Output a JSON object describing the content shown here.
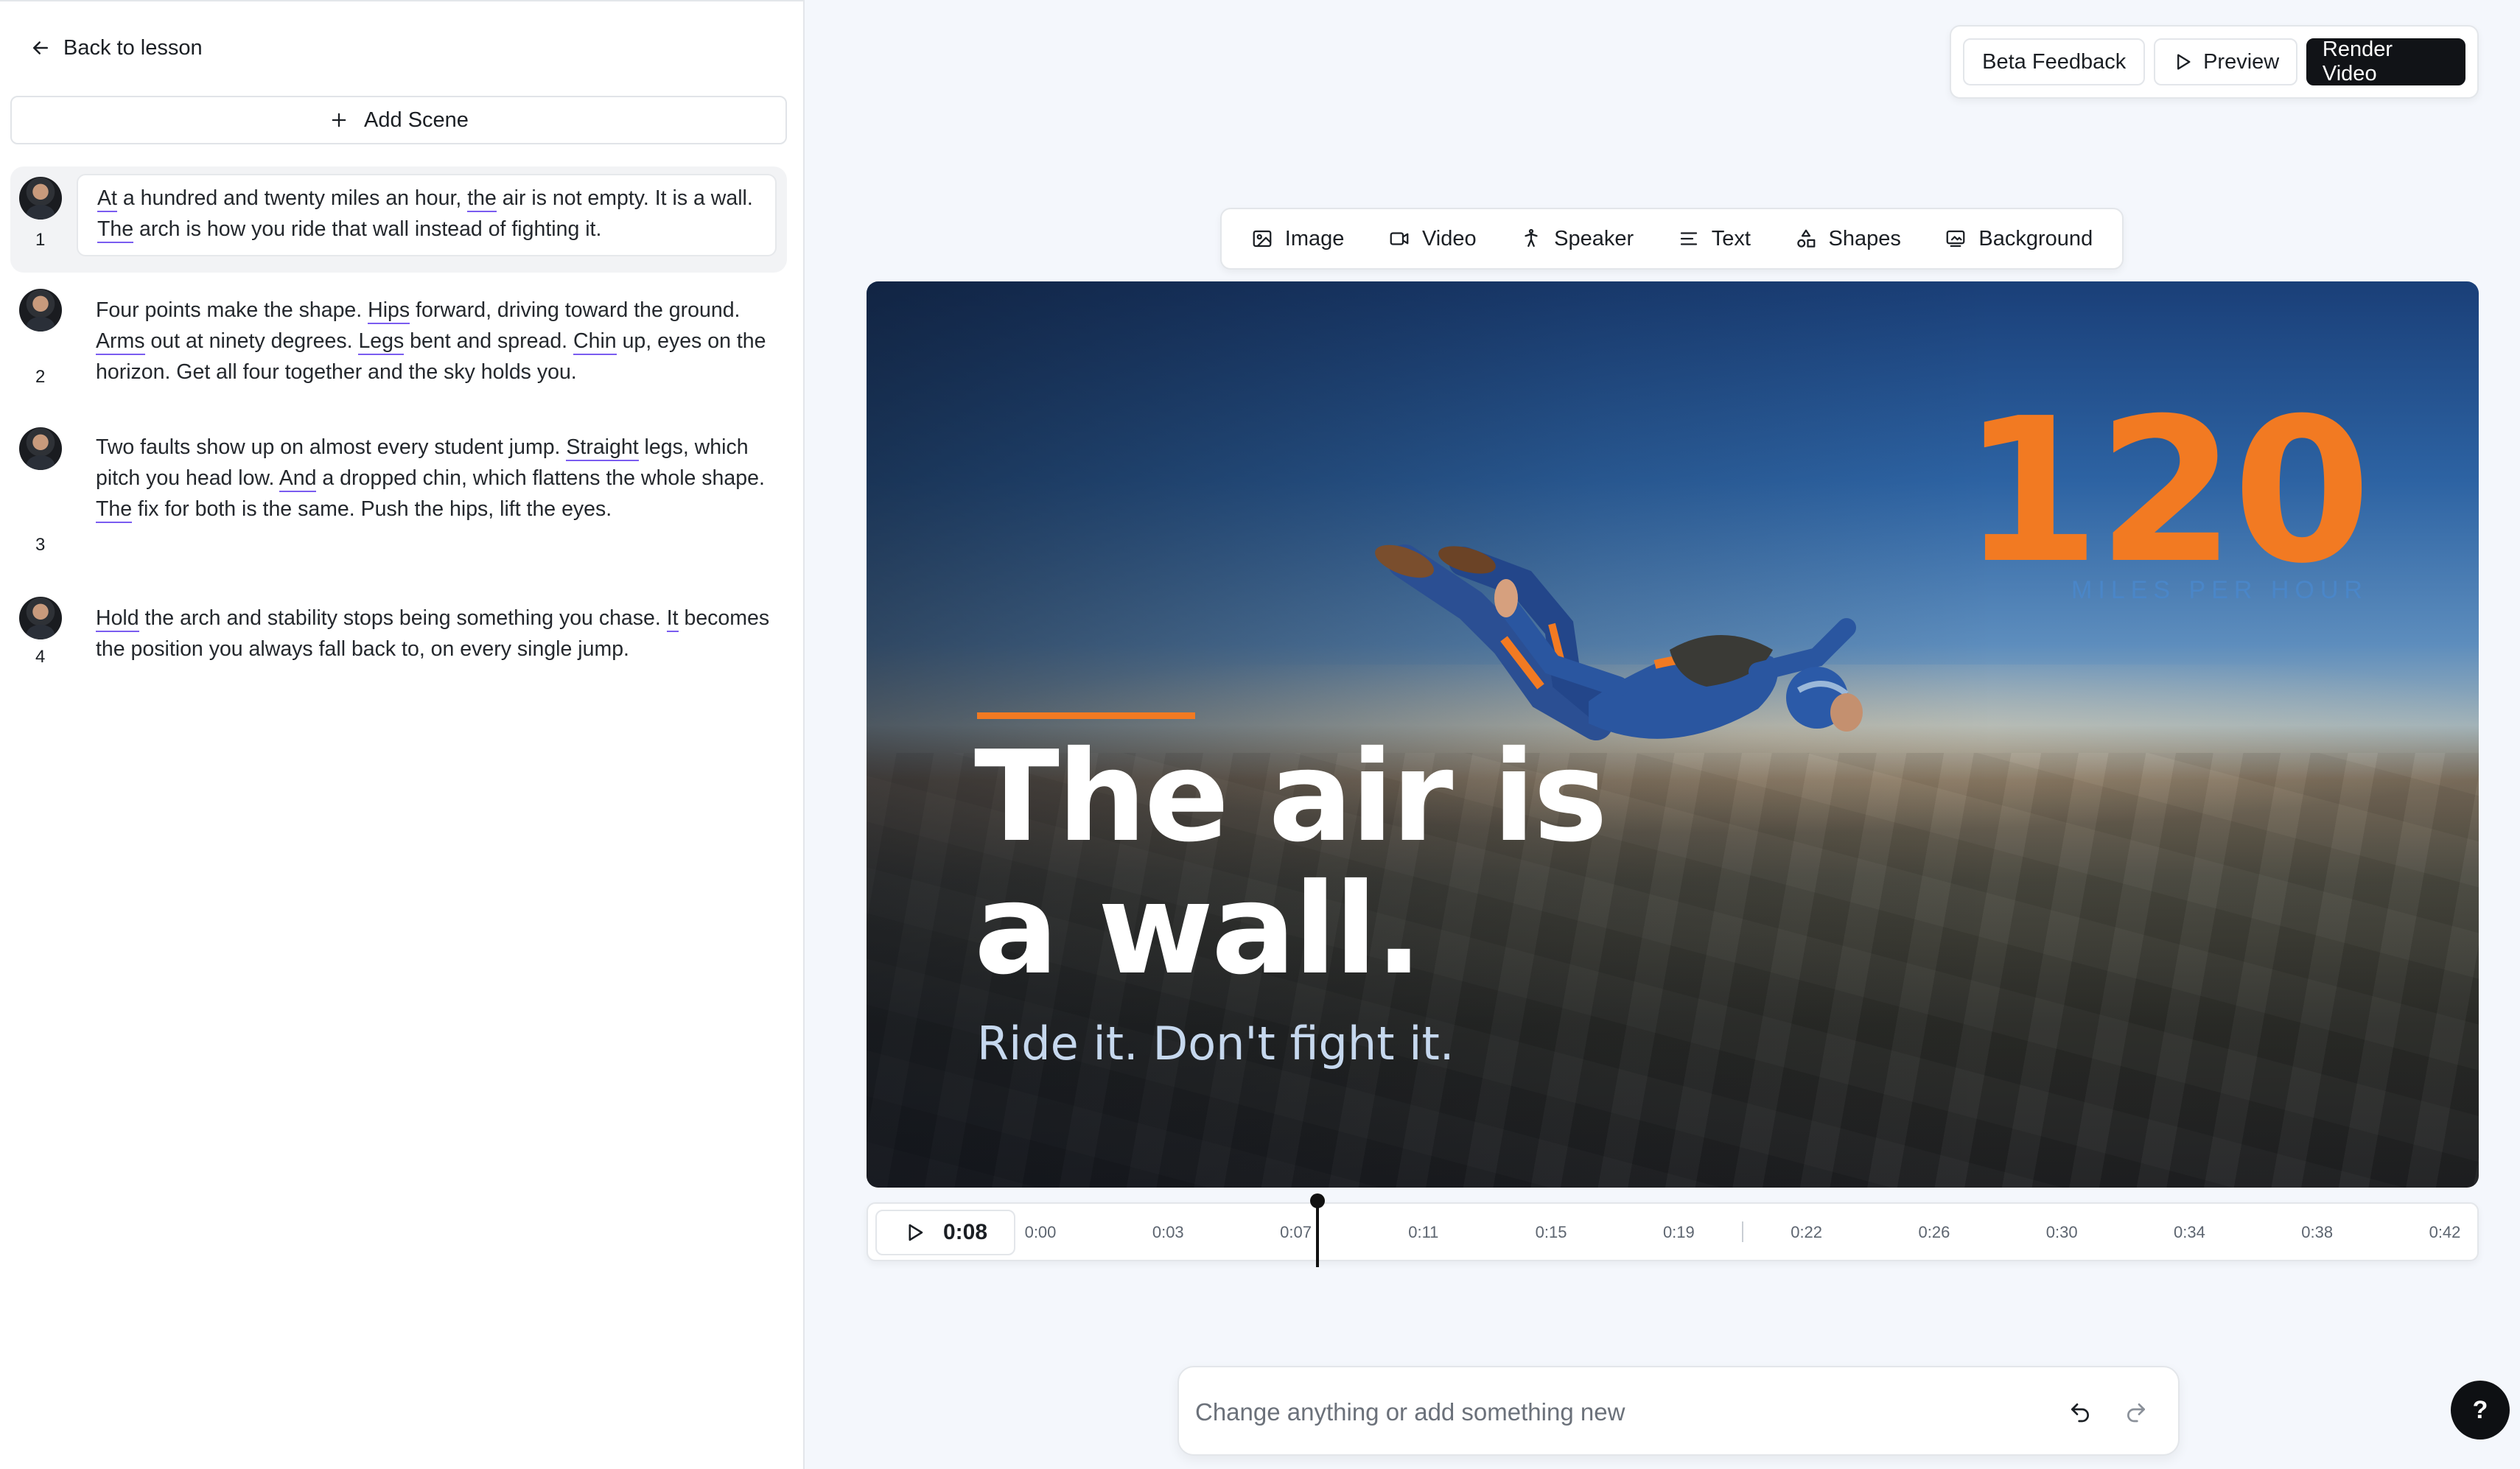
{
  "nav": {
    "back_label": "Back to lesson"
  },
  "sidebar": {
    "add_scene_label": "Add Scene",
    "scenes": [
      {
        "number": "1",
        "active": true,
        "text": "At a hundred and twenty miles an hour, the air is not empty. It is a wall. The arch is how you ride that wall instead of fighting it."
      },
      {
        "number": "2",
        "active": false,
        "text": "Four points make the shape. Hips forward, driving toward the ground. Arms out at ninety degrees. Legs bent and spread. Chin up, eyes on the horizon. Get all four together and the sky holds you."
      },
      {
        "number": "3",
        "active": false,
        "text": "Two faults show up on almost every student jump. Straight legs, which pitch you head low. And a dropped chin, which flattens the whole shape. The fix for both is the same. Push the hips, lift the eyes."
      },
      {
        "number": "4",
        "active": false,
        "text": "Hold the arch and stability stops being something you chase. It becomes the position you always fall back to, on every single jump."
      }
    ]
  },
  "actions": {
    "feedback_label": "Beta Feedback",
    "preview_label": "Preview",
    "render_label": "Render Video"
  },
  "toolbar": {
    "items": [
      {
        "label": "Image",
        "icon": "image-icon"
      },
      {
        "label": "Video",
        "icon": "video-icon"
      },
      {
        "label": "Speaker",
        "icon": "speaker-icon"
      },
      {
        "label": "Text",
        "icon": "text-icon"
      },
      {
        "label": "Shapes",
        "icon": "shapes-icon"
      },
      {
        "label": "Background",
        "icon": "background-icon"
      }
    ]
  },
  "canvas": {
    "headline_line1": "The air is",
    "headline_line2": "a wall.",
    "subline": "Ride it. Don't fight it.",
    "stat_value": "120",
    "stat_unit": "MILES PER HOUR",
    "accent_color": "#f27a22",
    "image_subject": "skydiver in freefall above farmland"
  },
  "timeline": {
    "current_time": "0:08",
    "ticks": [
      "0:00",
      "0:03",
      "0:07",
      "0:11",
      "0:15",
      "0:19",
      "0:22",
      "0:26",
      "0:30",
      "0:34",
      "0:38",
      "0:42"
    ]
  },
  "prompt": {
    "placeholder": "Change anything or add something new",
    "undo_icon": "undo-icon",
    "redo_icon": "redo-icon"
  },
  "help": {
    "label": "?"
  }
}
